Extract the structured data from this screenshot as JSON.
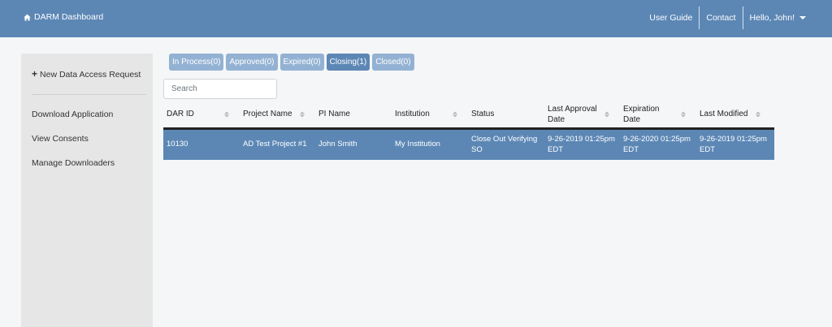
{
  "header": {
    "brand": "DARM Dashboard",
    "nav": [
      "User Guide",
      "Contact"
    ],
    "user_menu": "Hello, John!"
  },
  "sidebar": {
    "new_request": "New Data Access Request",
    "items": [
      "Download Application",
      "View Consents",
      "Manage Downloaders"
    ]
  },
  "tabs": [
    {
      "label": "In Process(0)",
      "active": false
    },
    {
      "label": "Approved(0)",
      "active": false
    },
    {
      "label": "Expired(0)",
      "active": false
    },
    {
      "label": "Closing(1)",
      "active": true
    },
    {
      "label": "Closed(0)",
      "active": false
    }
  ],
  "search": {
    "placeholder": "Search",
    "value": ""
  },
  "table": {
    "columns": [
      {
        "line1": "DAR ID",
        "line2": "",
        "sortable": true
      },
      {
        "line1": "Project Name",
        "line2": "",
        "sortable": true
      },
      {
        "line1": "PI Name",
        "line2": "",
        "sortable": false
      },
      {
        "line1": "Institution",
        "line2": "",
        "sortable": true
      },
      {
        "line1": "Status",
        "line2": "",
        "sortable": false
      },
      {
        "line1": "Last Approval",
        "line2": "Date",
        "sortable": true
      },
      {
        "line1": "Expiration",
        "line2": "Date",
        "sortable": true
      },
      {
        "line1": "Last Modified",
        "line2": "",
        "sortable": true
      }
    ],
    "rows": [
      {
        "selected": true,
        "cells": [
          {
            "line1": "10130",
            "line2": ""
          },
          {
            "line1": "AD Test Project #1",
            "line2": ""
          },
          {
            "line1": "John Smith",
            "line2": ""
          },
          {
            "line1": "My Institution",
            "line2": ""
          },
          {
            "line1": "Close Out Verifying",
            "line2": "SO"
          },
          {
            "line1": "9-26-2019 01:25pm",
            "line2": "EDT"
          },
          {
            "line1": "9-26-2020 01:25pm",
            "line2": "EDT"
          },
          {
            "line1": "9-26-2019 01:25pm",
            "line2": "EDT"
          }
        ]
      }
    ]
  },
  "colors": {
    "header_bg": "#5c87b5",
    "tab_bg": "#93b2d3",
    "tab_active_bg": "#5c87b5",
    "selected_row_bg": "#5c87b5",
    "sidebar_bg": "#e6e6e6",
    "page_bg": "#f5f6f8"
  },
  "icons": {
    "brand": "home-icon",
    "user_menu": "caret-down-icon",
    "new_request": "plus-icon",
    "sort": "sort-icon"
  }
}
